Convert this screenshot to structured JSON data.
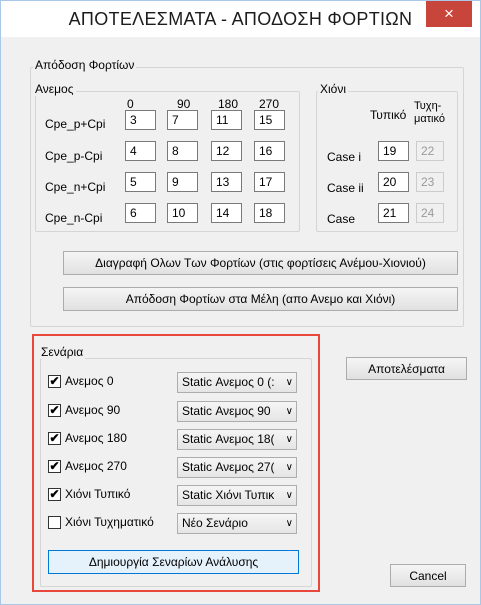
{
  "window": {
    "title": "ΑΠΟΤΕΛΕΣΜΑΤΑ - ΑΠΟΔΟΣΗ ΦΟΡΤΙΩΝ",
    "close_glyph": "×"
  },
  "load_assignment": {
    "label": "Απόδοση Φορτίων",
    "wind": {
      "label": "Ανεμος",
      "columns": [
        "0",
        "90",
        "180",
        "270"
      ],
      "rows": [
        {
          "label": "Cpe_p+Cpi",
          "values": [
            "3",
            "7",
            "11",
            "15"
          ]
        },
        {
          "label": "Cpe_p-Cpi",
          "values": [
            "4",
            "8",
            "12",
            "16"
          ]
        },
        {
          "label": "Cpe_n+Cpi",
          "values": [
            "5",
            "9",
            "13",
            "17"
          ]
        },
        {
          "label": "Cpe_n-Cpi",
          "values": [
            "6",
            "10",
            "14",
            "18"
          ]
        }
      ]
    },
    "snow": {
      "label": "Χιόνι",
      "col_typical": "Τυπικό",
      "col_accidental_line1": "Τυχη-",
      "col_accidental_line2": "ματικό",
      "rows": [
        {
          "label": "Case i",
          "typical": "19",
          "accidental": "22"
        },
        {
          "label": "Case ii",
          "typical": "20",
          "accidental": "23"
        },
        {
          "label": "Case",
          "typical": "21",
          "accidental": "24"
        }
      ]
    },
    "delete_button": "Διαγραφή Ολων Των Φορτίων (στις φορτίσεις Ανέμου-Χιονιού)",
    "assign_button": "Απόδοση Φορτίων στα Μέλη (απο Ανεμο και Χιόνι)"
  },
  "scenarios": {
    "label": "Σενάρια",
    "items": [
      {
        "label": "Ανεμος 0",
        "checked": true,
        "combo": "Static Ανεμος 0 (:"
      },
      {
        "label": "Ανεμος 90",
        "checked": true,
        "combo": "Static Ανεμος 90"
      },
      {
        "label": "Ανεμος 180",
        "checked": true,
        "combo": "Static Ανεμος 18("
      },
      {
        "label": "Ανεμος 270",
        "checked": true,
        "combo": "Static Ανεμος 27("
      },
      {
        "label": "Χιόνι Τυπικό",
        "checked": true,
        "combo": "Static Χιόνι Τυπικ"
      },
      {
        "label": "Χιόνι Τυχηματικό",
        "checked": false,
        "combo": "Νέο Σενάριο"
      }
    ],
    "create_button": "Δημιουργία Σεναρίων Ανάλυσης",
    "check_glyph": "✔",
    "dropdown_glyph": "∨"
  },
  "results_button": "Αποτελέσματα",
  "cancel_button": "Cancel",
  "colors": {
    "highlight_border": "#e8473b",
    "close_button": "#c7453a",
    "focus_button": "#0078d7"
  }
}
